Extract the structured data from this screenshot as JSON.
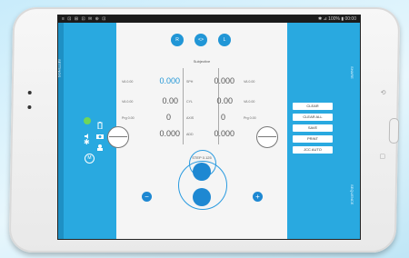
{
  "status": {
    "left": "≡ ⊡ ⊞ ⊡ ✉ ⊕ ⊡",
    "right": "✱ ⊿ 100% ▮ 00:00"
  },
  "left_panel": {
    "side_label": "SETTINGS"
  },
  "top_buttons": [
    {
      "label": "R"
    },
    {
      "label": "<>"
    },
    {
      "label": "L"
    }
  ],
  "screen_title": "Subjective",
  "rows": [
    {
      "left_label": "VA 0.00",
      "left_value": "0.000",
      "center_label": "SPH",
      "center_value": "0.000",
      "right_label": "VA 0.00"
    },
    {
      "left_label": "VA 0.00",
      "left_value": "0.00",
      "center_label": "CYL",
      "center_value": "0.00",
      "right_label": "VA 0.00"
    },
    {
      "left_label": "Prg 0.00",
      "left_value": "0",
      "center_label": "AXIS",
      "center_value": "0",
      "right_label": "Prg 0.00"
    },
    {
      "left_label": "",
      "left_value": "0.000",
      "center_label": "ADD",
      "center_value": "0.000",
      "right_label": ""
    }
  ],
  "step_label": "STEP 0.125",
  "controls": {
    "minus": "−",
    "plus": "+"
  },
  "action_buttons": [
    "CLEAR",
    "CLEAR ALL",
    "SAVE",
    "PRINT",
    "JCC AUTO"
  ],
  "right_panel": {
    "side_label_top": "SHARE",
    "side_label_bottom": "SEQUENCE"
  },
  "colors": {
    "accent": "#29a9e0",
    "button": "#1e88d2",
    "green": "#6fd65a"
  }
}
